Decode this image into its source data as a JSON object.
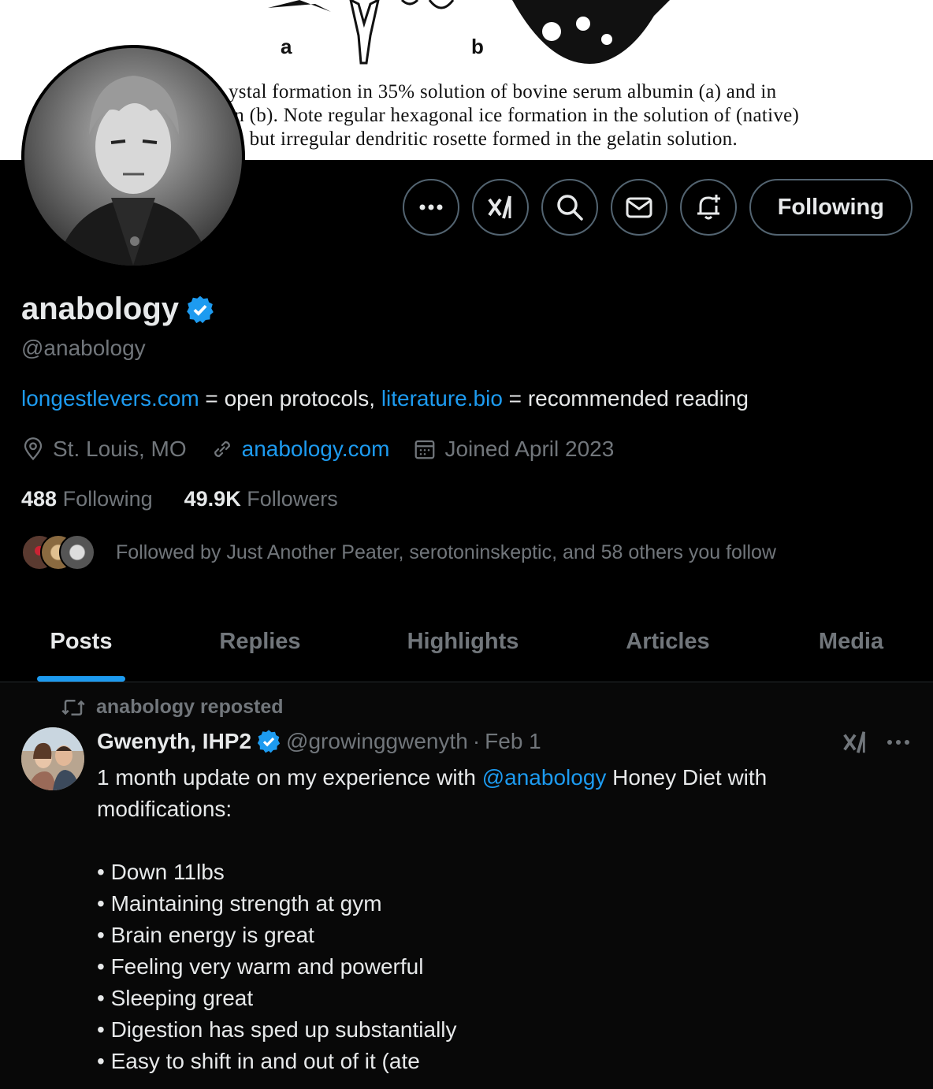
{
  "banner": {
    "fig_label_a": "a",
    "fig_label_b": "b",
    "caption_lines": [
      "ystal formation in 35% solution of bovine serum albumin (a) and in",
      "in (b). Note regular hexagonal ice formation in the solution of (native)",
      "in but irregular dendritic rosette formed in the gelatin solution."
    ]
  },
  "profile": {
    "display_name": "anabology",
    "handle": "@anabology",
    "bio": {
      "link1": "longestlevers.com",
      "text1": " = open protocols, ",
      "link2": "literature.bio",
      "text2": " = recommended reading"
    },
    "location": "St. Louis, MO",
    "website": "anabology.com",
    "joined": "Joined April 2023",
    "following_count": "488",
    "following_label": "Following",
    "followers_count": "49.9K",
    "followers_label": "Followers",
    "followed_by": "Followed by Just Another Peater, serotoninskeptic, and 58 others you follow"
  },
  "actions": {
    "follow_label": "Following",
    "icons": [
      "more-icon",
      "grok-icon",
      "search-icon",
      "message-icon",
      "notify-icon"
    ]
  },
  "tabs": [
    {
      "label": "Posts",
      "active": true
    },
    {
      "label": "Replies",
      "active": false
    },
    {
      "label": "Highlights",
      "active": false
    },
    {
      "label": "Articles",
      "active": false
    },
    {
      "label": "Media",
      "active": false
    }
  ],
  "post": {
    "repost_label": "anabology reposted",
    "author": "Gwenyth, IHP2",
    "handle": "@growinggwenyth",
    "separator": "·",
    "date": "Feb 1",
    "line1_a": "1 month update on my experience with ",
    "line1_mention": "@anabology",
    "line1_b": " Honey Diet with",
    "line2": "modifications:",
    "bullets": [
      "• Down 11lbs",
      "• Maintaining strength at gym",
      "• Brain energy is great",
      "• Feeling very warm and powerful",
      "• Sleeping great",
      "• Digestion has sped up substantially",
      "• Easy to shift in and out of it (ate"
    ]
  },
  "colors": {
    "accent": "#1d9bf0",
    "background": "#000000",
    "muted": "#71767b",
    "text": "#e7e9ea",
    "border": "#2f3336"
  }
}
